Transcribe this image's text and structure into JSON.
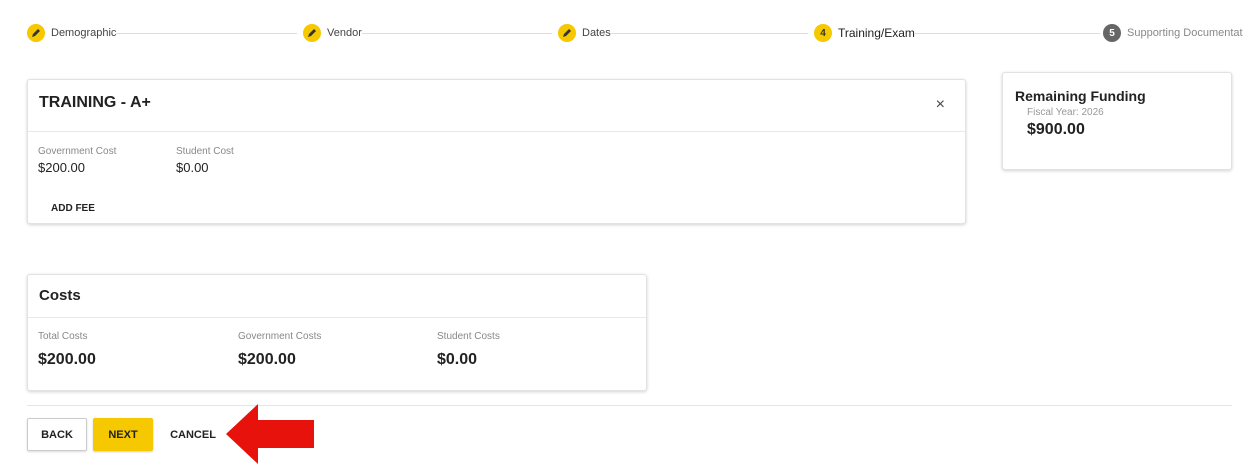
{
  "stepper": {
    "steps": [
      {
        "label": "Demographic",
        "status": "done",
        "icon": "pencil-icon"
      },
      {
        "label": "Vendor",
        "status": "done",
        "icon": "pencil-icon"
      },
      {
        "label": "Dates",
        "status": "done",
        "icon": "pencil-icon"
      },
      {
        "label": "Training/Exam",
        "status": "active",
        "number": "4"
      },
      {
        "label": "Supporting Documentation",
        "status": "todo",
        "number": "5"
      }
    ]
  },
  "training": {
    "title": "TRAINING - A+",
    "close_icon": "×",
    "government_cost_label": "Government Cost",
    "government_cost_value": "$200.00",
    "student_cost_label": "Student Cost",
    "student_cost_value": "$0.00",
    "add_fee_label": "ADD FEE"
  },
  "funding": {
    "title": "Remaining Funding",
    "fiscal_year": "Fiscal Year: 2026",
    "amount": "$900.00"
  },
  "costs": {
    "title": "Costs",
    "total_label": "Total Costs",
    "total_value": "$200.00",
    "government_label": "Government Costs",
    "government_value": "$200.00",
    "student_label": "Student Costs",
    "student_value": "$0.00"
  },
  "actions": {
    "back_label": "BACK",
    "next_label": "NEXT",
    "cancel_label": "CANCEL"
  },
  "colors": {
    "accent": "#f5c800",
    "annotation_arrow": "#e8120c",
    "step_todo": "#666666"
  }
}
